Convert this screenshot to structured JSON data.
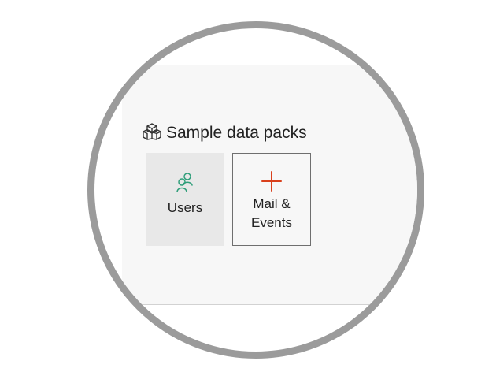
{
  "section": {
    "title": "Sample data packs",
    "title_icon": "package-icon"
  },
  "packs": [
    {
      "label": "Users",
      "icon": "users-icon",
      "icon_color": "#2f9e7a",
      "selected": true
    },
    {
      "label": "Mail & Events",
      "icon": "plus-icon",
      "icon_color": "#d9401c",
      "selected": false
    }
  ],
  "colors": {
    "frame": "#9b9b9b",
    "panel": "#f7f7f7",
    "selected_card": "#e8e8e8"
  }
}
